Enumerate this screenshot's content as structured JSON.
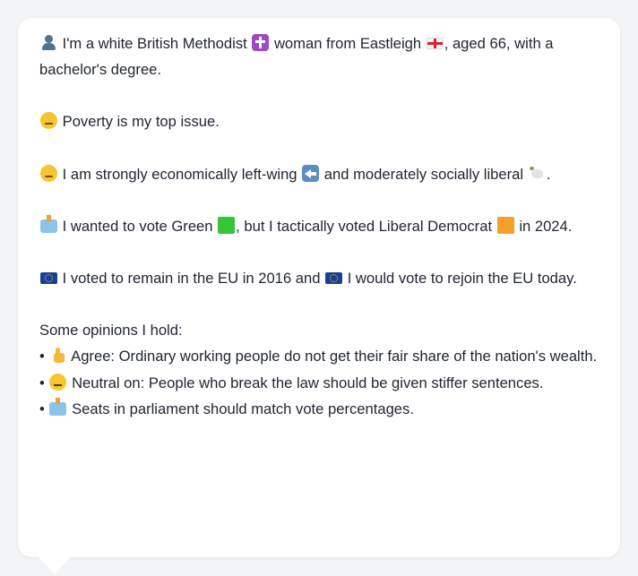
{
  "card": {
    "identity": {
      "icon": "bust-in-silhouette-icon",
      "t1": "I'm a white British Methodist",
      "icon2": "latin-cross-icon",
      "t2": "woman from Eastleigh",
      "icon3": "england-flag-icon",
      "t3": ", aged 66, with a bachelor's degree."
    },
    "issue": {
      "icon": "disappointed-face-icon",
      "text": "Poverty is my top issue."
    },
    "ideology": {
      "icon": "thinking-face-icon",
      "t1": "I am strongly economically left-wing",
      "icon2": "left-arrow-icon",
      "t2": "and moderately socially liberal",
      "icon3": "dove-icon",
      "t3": "."
    },
    "vote": {
      "icon": "ballot-box-icon",
      "t1": "I wanted to vote Green",
      "icon2": "green-square-icon",
      "t2": ", but I tactically voted Liberal Democrat",
      "icon3": "orange-square-icon",
      "t3": "in 2024."
    },
    "eu": {
      "icon": "eu-flag-icon",
      "t1": "I voted to remain in the EU in 2016 and",
      "icon2": "eu-flag-icon",
      "t2": "I would vote to rejoin the EU today."
    },
    "opinions": {
      "heading": "Some opinions I hold:",
      "bullet": "•",
      "items": [
        {
          "icon": "thumbs-up-icon",
          "text": "Agree: Ordinary working people do not get their fair share of the nation's wealth."
        },
        {
          "icon": "neutral-face-icon",
          "text": "Neutral on: People who break the law should be given stiffer sentences."
        },
        {
          "icon": "ballot-box-icon",
          "text": "Seats in parliament should match vote percentages."
        }
      ]
    }
  }
}
